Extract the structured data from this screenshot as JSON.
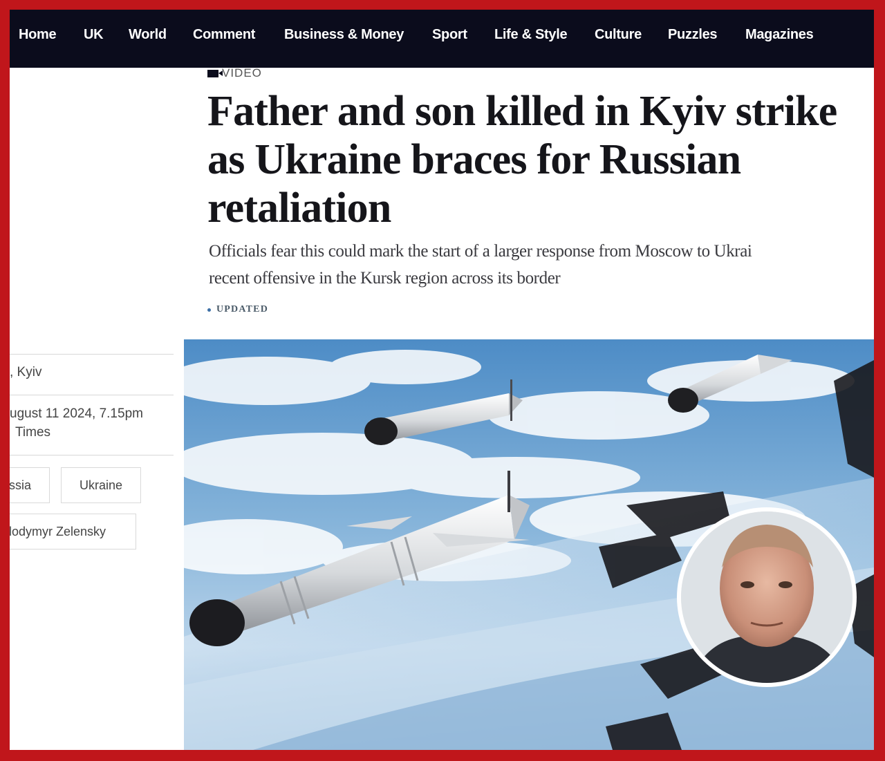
{
  "nav": {
    "items": [
      "Home",
      "UK",
      "World",
      "Comment",
      "Business & Money",
      "Sport",
      "Life & Style",
      "Culture",
      "Puzzles",
      "Magazines"
    ]
  },
  "article": {
    "label": "VIDEO",
    "headline": [
      "Father and son killed in Kyiv strike",
      "as Ukraine braces for Russian",
      "retaliation"
    ],
    "standfirst": [
      "Officials fear this could mark the start of a larger response from Moscow to Ukrai",
      "recent offensive in  the Kursk region across its border"
    ],
    "status": "UPDATED"
  },
  "sidebar": {
    "location": ", Kyiv",
    "date": "ugust 11 2024, 7.15pm",
    "timezone": "Times",
    "tags": [
      "ssia",
      "Ukraine",
      "lodymyr Zelensky"
    ]
  },
  "colors": {
    "frame": "#c0161b",
    "nav_bg": "#0b0c1c",
    "headline": "#15151a"
  },
  "hero": {
    "image": "missiles-in-sky-photo",
    "inset": "portrait-circle"
  }
}
